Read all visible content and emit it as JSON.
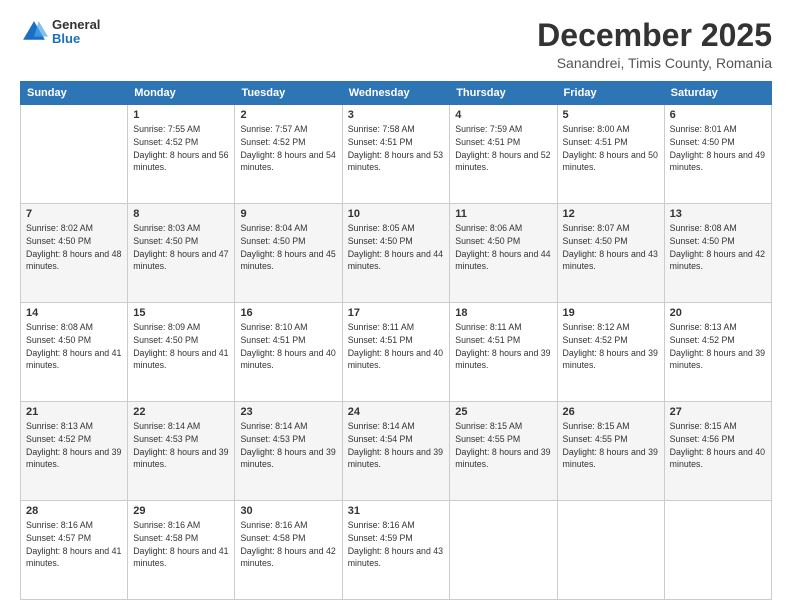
{
  "logo": {
    "general": "General",
    "blue": "Blue"
  },
  "header": {
    "month": "December 2025",
    "location": "Sanandrei, Timis County, Romania"
  },
  "weekdays": [
    "Sunday",
    "Monday",
    "Tuesday",
    "Wednesday",
    "Thursday",
    "Friday",
    "Saturday"
  ],
  "weeks": [
    [
      {
        "day": "",
        "sunrise": "",
        "sunset": "",
        "daylight": ""
      },
      {
        "day": "1",
        "sunrise": "Sunrise: 7:55 AM",
        "sunset": "Sunset: 4:52 PM",
        "daylight": "Daylight: 8 hours and 56 minutes."
      },
      {
        "day": "2",
        "sunrise": "Sunrise: 7:57 AM",
        "sunset": "Sunset: 4:52 PM",
        "daylight": "Daylight: 8 hours and 54 minutes."
      },
      {
        "day": "3",
        "sunrise": "Sunrise: 7:58 AM",
        "sunset": "Sunset: 4:51 PM",
        "daylight": "Daylight: 8 hours and 53 minutes."
      },
      {
        "day": "4",
        "sunrise": "Sunrise: 7:59 AM",
        "sunset": "Sunset: 4:51 PM",
        "daylight": "Daylight: 8 hours and 52 minutes."
      },
      {
        "day": "5",
        "sunrise": "Sunrise: 8:00 AM",
        "sunset": "Sunset: 4:51 PM",
        "daylight": "Daylight: 8 hours and 50 minutes."
      },
      {
        "day": "6",
        "sunrise": "Sunrise: 8:01 AM",
        "sunset": "Sunset: 4:50 PM",
        "daylight": "Daylight: 8 hours and 49 minutes."
      }
    ],
    [
      {
        "day": "7",
        "sunrise": "Sunrise: 8:02 AM",
        "sunset": "Sunset: 4:50 PM",
        "daylight": "Daylight: 8 hours and 48 minutes."
      },
      {
        "day": "8",
        "sunrise": "Sunrise: 8:03 AM",
        "sunset": "Sunset: 4:50 PM",
        "daylight": "Daylight: 8 hours and 47 minutes."
      },
      {
        "day": "9",
        "sunrise": "Sunrise: 8:04 AM",
        "sunset": "Sunset: 4:50 PM",
        "daylight": "Daylight: 8 hours and 45 minutes."
      },
      {
        "day": "10",
        "sunrise": "Sunrise: 8:05 AM",
        "sunset": "Sunset: 4:50 PM",
        "daylight": "Daylight: 8 hours and 44 minutes."
      },
      {
        "day": "11",
        "sunrise": "Sunrise: 8:06 AM",
        "sunset": "Sunset: 4:50 PM",
        "daylight": "Daylight: 8 hours and 44 minutes."
      },
      {
        "day": "12",
        "sunrise": "Sunrise: 8:07 AM",
        "sunset": "Sunset: 4:50 PM",
        "daylight": "Daylight: 8 hours and 43 minutes."
      },
      {
        "day": "13",
        "sunrise": "Sunrise: 8:08 AM",
        "sunset": "Sunset: 4:50 PM",
        "daylight": "Daylight: 8 hours and 42 minutes."
      }
    ],
    [
      {
        "day": "14",
        "sunrise": "Sunrise: 8:08 AM",
        "sunset": "Sunset: 4:50 PM",
        "daylight": "Daylight: 8 hours and 41 minutes."
      },
      {
        "day": "15",
        "sunrise": "Sunrise: 8:09 AM",
        "sunset": "Sunset: 4:50 PM",
        "daylight": "Daylight: 8 hours and 41 minutes."
      },
      {
        "day": "16",
        "sunrise": "Sunrise: 8:10 AM",
        "sunset": "Sunset: 4:51 PM",
        "daylight": "Daylight: 8 hours and 40 minutes."
      },
      {
        "day": "17",
        "sunrise": "Sunrise: 8:11 AM",
        "sunset": "Sunset: 4:51 PM",
        "daylight": "Daylight: 8 hours and 40 minutes."
      },
      {
        "day": "18",
        "sunrise": "Sunrise: 8:11 AM",
        "sunset": "Sunset: 4:51 PM",
        "daylight": "Daylight: 8 hours and 39 minutes."
      },
      {
        "day": "19",
        "sunrise": "Sunrise: 8:12 AM",
        "sunset": "Sunset: 4:52 PM",
        "daylight": "Daylight: 8 hours and 39 minutes."
      },
      {
        "day": "20",
        "sunrise": "Sunrise: 8:13 AM",
        "sunset": "Sunset: 4:52 PM",
        "daylight": "Daylight: 8 hours and 39 minutes."
      }
    ],
    [
      {
        "day": "21",
        "sunrise": "Sunrise: 8:13 AM",
        "sunset": "Sunset: 4:52 PM",
        "daylight": "Daylight: 8 hours and 39 minutes."
      },
      {
        "day": "22",
        "sunrise": "Sunrise: 8:14 AM",
        "sunset": "Sunset: 4:53 PM",
        "daylight": "Daylight: 8 hours and 39 minutes."
      },
      {
        "day": "23",
        "sunrise": "Sunrise: 8:14 AM",
        "sunset": "Sunset: 4:53 PM",
        "daylight": "Daylight: 8 hours and 39 minutes."
      },
      {
        "day": "24",
        "sunrise": "Sunrise: 8:14 AM",
        "sunset": "Sunset: 4:54 PM",
        "daylight": "Daylight: 8 hours and 39 minutes."
      },
      {
        "day": "25",
        "sunrise": "Sunrise: 8:15 AM",
        "sunset": "Sunset: 4:55 PM",
        "daylight": "Daylight: 8 hours and 39 minutes."
      },
      {
        "day": "26",
        "sunrise": "Sunrise: 8:15 AM",
        "sunset": "Sunset: 4:55 PM",
        "daylight": "Daylight: 8 hours and 39 minutes."
      },
      {
        "day": "27",
        "sunrise": "Sunrise: 8:15 AM",
        "sunset": "Sunset: 4:56 PM",
        "daylight": "Daylight: 8 hours and 40 minutes."
      }
    ],
    [
      {
        "day": "28",
        "sunrise": "Sunrise: 8:16 AM",
        "sunset": "Sunset: 4:57 PM",
        "daylight": "Daylight: 8 hours and 41 minutes."
      },
      {
        "day": "29",
        "sunrise": "Sunrise: 8:16 AM",
        "sunset": "Sunset: 4:58 PM",
        "daylight": "Daylight: 8 hours and 41 minutes."
      },
      {
        "day": "30",
        "sunrise": "Sunrise: 8:16 AM",
        "sunset": "Sunset: 4:58 PM",
        "daylight": "Daylight: 8 hours and 42 minutes."
      },
      {
        "day": "31",
        "sunrise": "Sunrise: 8:16 AM",
        "sunset": "Sunset: 4:59 PM",
        "daylight": "Daylight: 8 hours and 43 minutes."
      },
      {
        "day": "",
        "sunrise": "",
        "sunset": "",
        "daylight": ""
      },
      {
        "day": "",
        "sunrise": "",
        "sunset": "",
        "daylight": ""
      },
      {
        "day": "",
        "sunrise": "",
        "sunset": "",
        "daylight": ""
      }
    ]
  ]
}
